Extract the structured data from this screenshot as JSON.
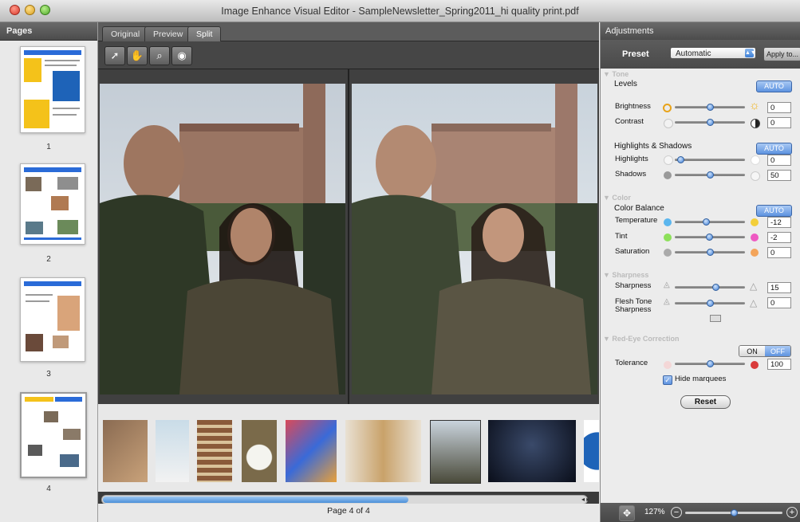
{
  "window": {
    "title": "Image Enhance Visual Editor - SampleNewsletter_Spring2011_hi quality print.pdf"
  },
  "pages_panel": {
    "title": "Pages",
    "page_numbers": [
      "1",
      "2",
      "3",
      "4"
    ]
  },
  "tabs": [
    "Original",
    "Preview",
    "Split"
  ],
  "active_tab": "Split",
  "tools": [
    {
      "name": "arrow-icon",
      "glyph": "➚"
    },
    {
      "name": "hand-icon",
      "glyph": "✋"
    },
    {
      "name": "magnifier-icon",
      "glyph": "⌕"
    },
    {
      "name": "eye-icon",
      "glyph": "◉"
    }
  ],
  "status": {
    "page_label": "Page 4 of 4"
  },
  "filmstrip": {
    "scroll_fraction": 0.63,
    "arrows": "◂ ▸"
  },
  "adjustments": {
    "title": "Adjustments",
    "preset_label": "Preset",
    "preset_value": "Automatic",
    "apply_to": "Apply to...",
    "tone": {
      "section": "Tone",
      "levels_label": "Levels",
      "auto_label": "AUTO",
      "brightness_label": "Brightness",
      "brightness_value": "0",
      "brightness_pos": 0.5,
      "contrast_label": "Contrast",
      "contrast_value": "0",
      "contrast_pos": 0.5,
      "hs_label": "Highlights & Shadows",
      "hs_auto": "AUTO",
      "highlights_label": "Highlights",
      "highlights_value": "0",
      "highlights_pos": 0.08,
      "shadows_label": "Shadows",
      "shadows_value": "50",
      "shadows_pos": 0.5
    },
    "color": {
      "section": "Color",
      "balance_label": "Color Balance",
      "auto_label": "AUTO",
      "temperature_label": "Temperature",
      "temperature_value": "-12",
      "temperature_pos": 0.44,
      "tint_label": "Tint",
      "tint_value": "-2",
      "tint_pos": 0.49,
      "saturation_label": "Saturation",
      "saturation_value": "0",
      "saturation_pos": 0.5
    },
    "sharpness": {
      "section": "Sharpness",
      "sharpness_label": "Sharpness",
      "sharpness_value": "15",
      "sharpness_pos": 0.58,
      "flesh_label_1": "Flesh Tone",
      "flesh_label_2": "Sharpness",
      "flesh_value": "0",
      "flesh_pos": 0.5
    },
    "redeye": {
      "section": "Red-Eye Correction",
      "on_label": "ON",
      "off_label": "OFF",
      "tolerance_label": "Tolerance",
      "tolerance_value": "100",
      "tolerance_pos": 0.5,
      "hide_label": "Hide marquees",
      "reset_label": "Reset"
    },
    "zoom": {
      "value": "127%",
      "pos": 0.5
    }
  },
  "colors": {
    "accent": "#5e93e0",
    "panel_dark": "#4c4c4c"
  }
}
